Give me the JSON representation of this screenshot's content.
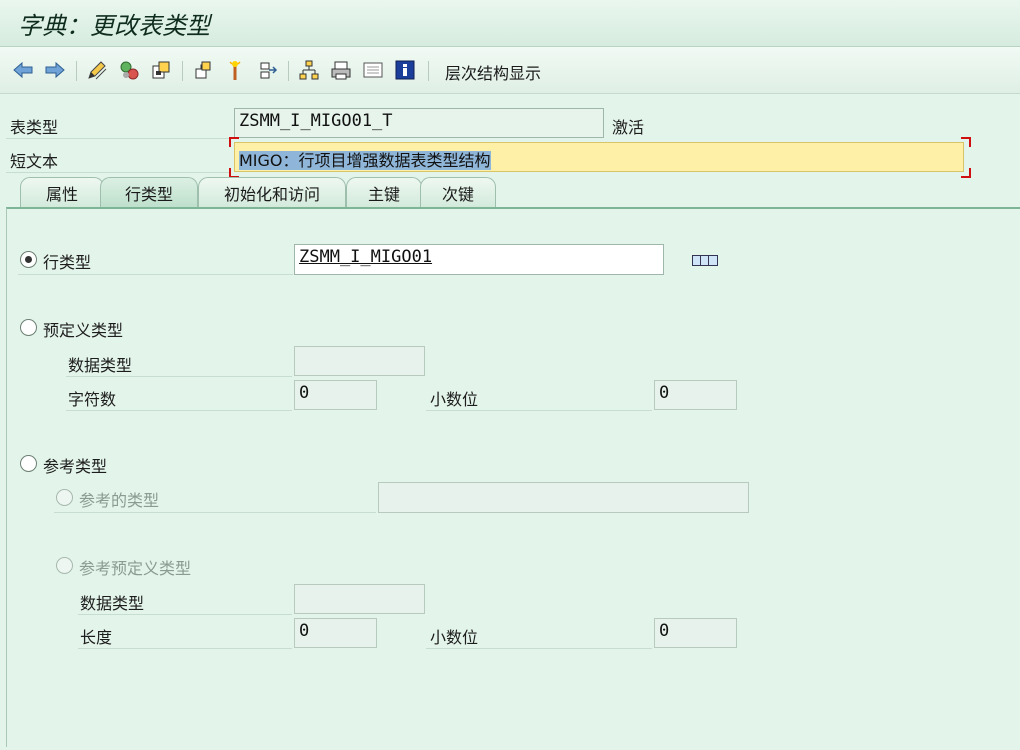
{
  "window": {
    "title": "字典：更改表类型"
  },
  "toolbar": {
    "hierarchy_label": "层次结构显示"
  },
  "header": {
    "table_type_label": "表类型",
    "table_type_value": "ZSMM_I_MIGO01_T",
    "status": "激活",
    "short_text_label": "短文本",
    "short_text_value": "MIGO：行项目增强数据表类型结构"
  },
  "tabs": [
    {
      "label": "属性"
    },
    {
      "label": "行类型",
      "active": true
    },
    {
      "label": "初始化和访问"
    },
    {
      "label": "主键"
    },
    {
      "label": "次键"
    }
  ],
  "line_type": {
    "row_type_label": "行类型",
    "row_type_value": "ZSMM_I_MIGO01",
    "predefined_label": "预定义类型",
    "data_type_label": "数据类型",
    "data_type_value": "",
    "char_count_label": "字符数",
    "char_count_value": "0",
    "decimals_label": "小数位",
    "decimals_value": "0",
    "ref_type_label": "参考类型",
    "ref_to_type_label": "参考的类型",
    "ref_to_type_value": "",
    "ref_predef_label": "参考预定义类型",
    "ref_data_type_label": "数据类型",
    "ref_data_type_value": "",
    "length_label": "长度",
    "length_value": "0",
    "ref_decimals_label": "小数位",
    "ref_decimals_value": "0"
  }
}
